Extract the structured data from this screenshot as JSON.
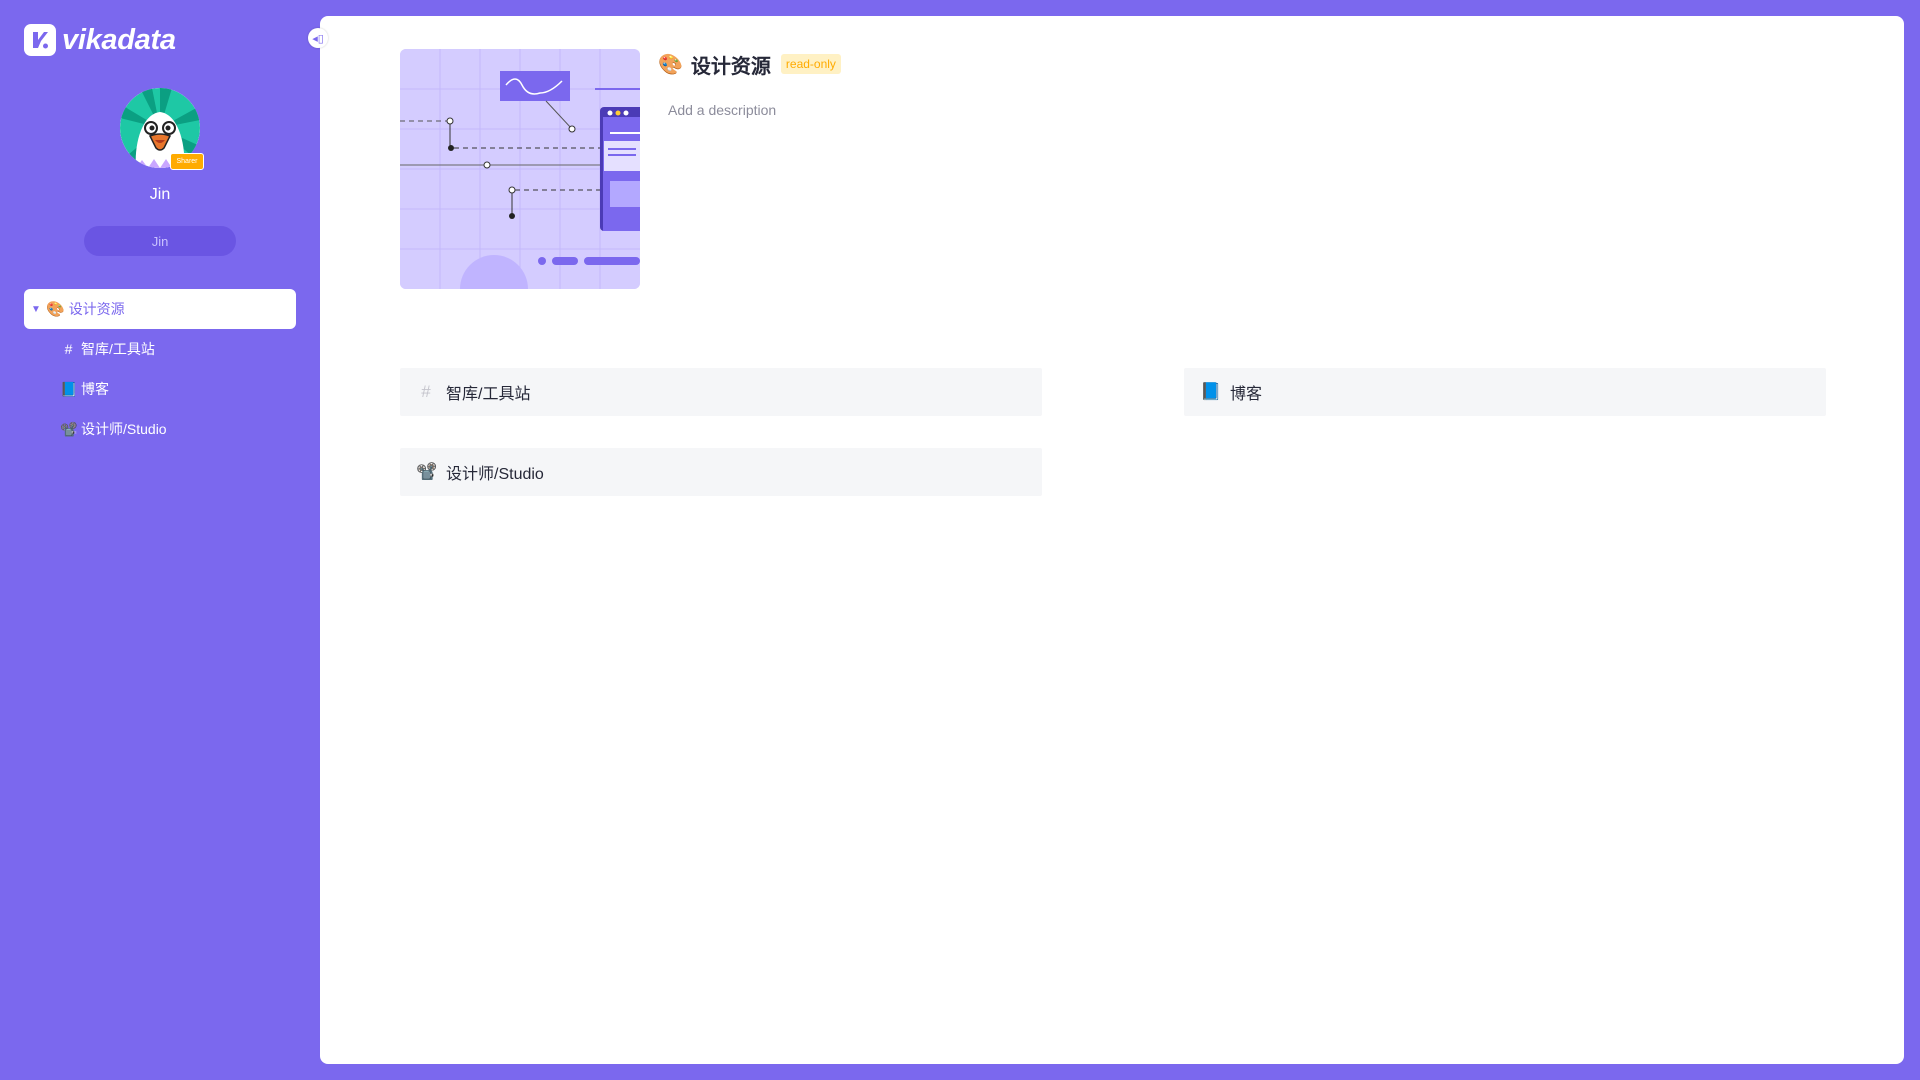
{
  "brand": {
    "name": "vikadata",
    "accent": "#7b68ee"
  },
  "user": {
    "name": "Jin",
    "badge": "Sharer",
    "pill_label": "Jin"
  },
  "sidebar": {
    "collapse_icon": "collapse-sidebar-icon",
    "root": {
      "label": "设计资源",
      "emoji": "🎨",
      "expanded": true
    },
    "items": [
      {
        "label": "智库/工具站",
        "emoji": "#"
      },
      {
        "label": "博客",
        "emoji": "📘"
      },
      {
        "label": "设计师/Studio",
        "emoji": "📽️"
      }
    ]
  },
  "folder": {
    "emoji": "🎨",
    "title": "设计资源",
    "permission": "read-only",
    "description_placeholder": "Add a description"
  },
  "cards": [
    {
      "label": "智库/工具站",
      "emoji": "#"
    },
    {
      "label": "博客",
      "emoji": "📘"
    },
    {
      "label": "设计师/Studio",
      "emoji": "📽️"
    }
  ]
}
